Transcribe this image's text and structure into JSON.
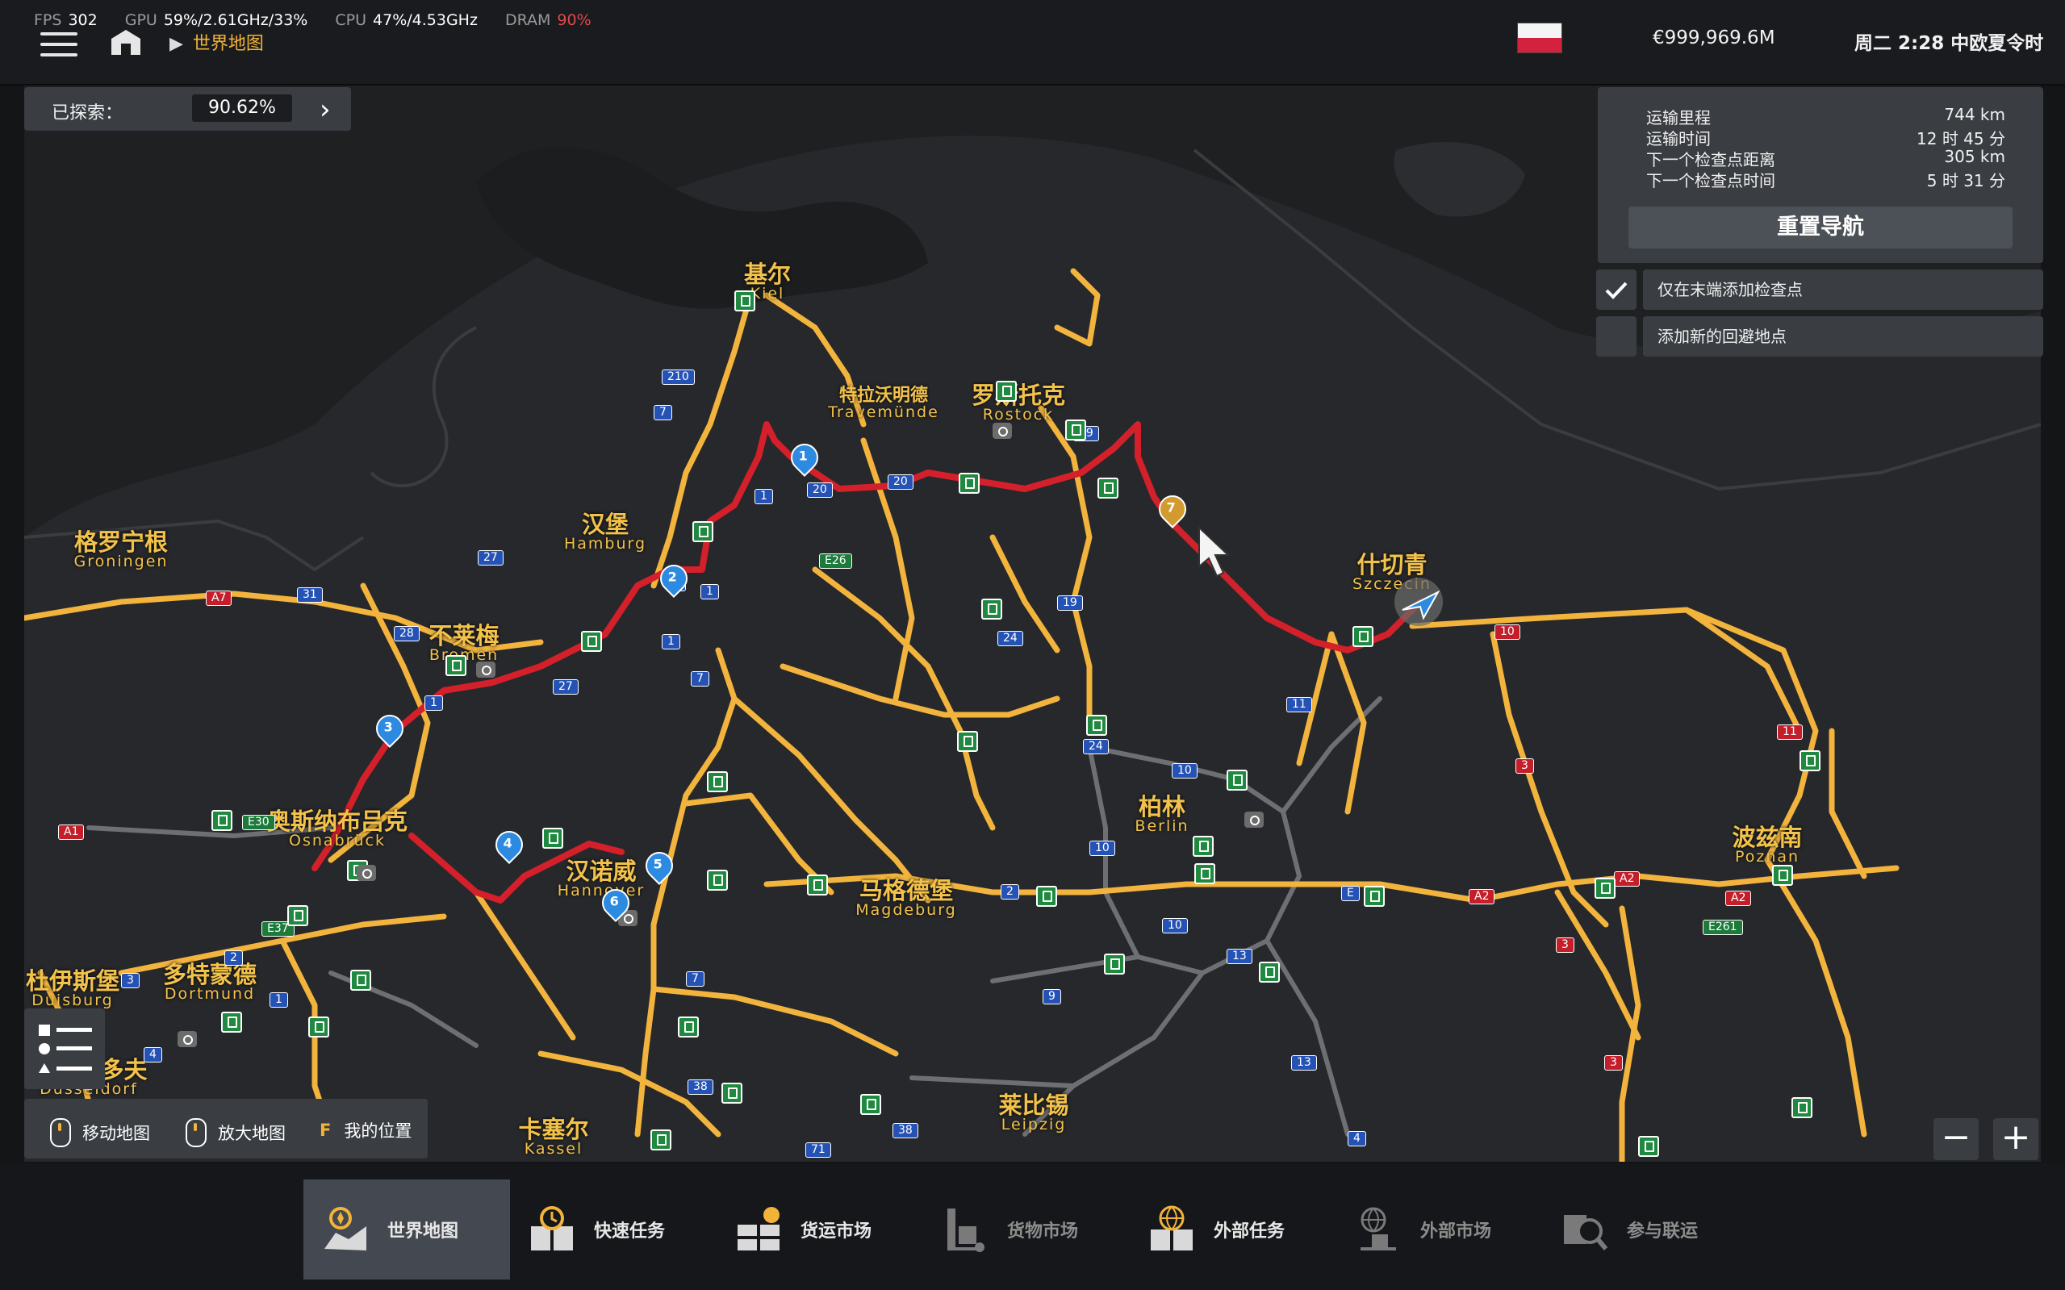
{
  "perf": {
    "fps_label": "FPS",
    "fps": "302",
    "gpu_label": "GPU",
    "gpu": "59%/2.61GHz/33%",
    "cpu_label": "CPU",
    "cpu": "47%/4.53GHz",
    "dram_label": "DRAM",
    "dram": "90%"
  },
  "header": {
    "breadcrumb": "世界地图",
    "money": "€999,969.6M",
    "clock": "周二 2:28 中欧夏令时"
  },
  "explored": {
    "label": "已探索：",
    "value": "90.62%"
  },
  "navigation": {
    "rows": [
      {
        "label": "运输里程",
        "value": "744 km"
      },
      {
        "label": "运输时间",
        "value": "12 时 45 分"
      },
      {
        "label": "下一个检查点距离",
        "value": "305 km"
      },
      {
        "label": "下一个检查点时间",
        "value": "5 时 31 分"
      }
    ],
    "reset_label": "重置导航",
    "options": [
      {
        "label": "仅在末端添加检查点",
        "checked": true
      },
      {
        "label": "添加新的回避地点",
        "checked": false
      }
    ]
  },
  "controls": {
    "move_label": "移动地图",
    "zoom_label": "放大地图",
    "locate_key": "F",
    "locate_label": "我的位置",
    "zoom_out": "−",
    "zoom_in": "+"
  },
  "cities": [
    {
      "cn": "基尔",
      "lat": "Kiel"
    },
    {
      "cn": "特拉沃明德",
      "lat": "Travemünde"
    },
    {
      "cn": "罗斯托克",
      "lat": "Rostock"
    },
    {
      "cn": "汉堡",
      "lat": "Hamburg"
    },
    {
      "cn": "格罗宁根",
      "lat": "Groningen"
    },
    {
      "cn": "不莱梅",
      "lat": "Bremen"
    },
    {
      "cn": "什切青",
      "lat": "Szczecin"
    },
    {
      "cn": "奥斯纳布吕克",
      "lat": "Osnabrück"
    },
    {
      "cn": "汉诺威",
      "lat": "Hannover"
    },
    {
      "cn": "柏林",
      "lat": "Berlin"
    },
    {
      "cn": "马格德堡",
      "lat": "Magdeburg"
    },
    {
      "cn": "波兹南",
      "lat": "Poznan"
    },
    {
      "cn": "杜伊斯堡",
      "lat": "Duisburg"
    },
    {
      "cn": "多特蒙德",
      "lat": "Dortmund"
    },
    {
      "cn": "杜塞尔多夫",
      "lat": "Düsseldorf"
    },
    {
      "cn": "卡塞尔",
      "lat": "Kassel"
    },
    {
      "cn": "莱比锡",
      "lat": "Leipzig"
    }
  ],
  "road_shields": [
    "210",
    "7",
    "1",
    "20",
    "20",
    "19",
    "E26",
    "2",
    "1",
    "A7",
    "31",
    "28",
    "27",
    "1",
    "27",
    "7",
    "24",
    "19",
    "10",
    "3",
    "11",
    "10",
    "11",
    "A1",
    "E30",
    "1",
    "24",
    "10",
    "E37",
    "2",
    "3",
    "1",
    "4",
    "7",
    "38",
    "71",
    "38",
    "9",
    "13",
    "4",
    "10",
    "2",
    "A2",
    "A2",
    "E261",
    "3",
    "3",
    "E",
    "A2",
    "13"
  ],
  "waypoints": [
    "1",
    "2",
    "3",
    "4",
    "5",
    "6",
    "7"
  ],
  "tabs": [
    {
      "label": "世界地图",
      "active": true
    },
    {
      "label": "快速任务"
    },
    {
      "label": "货运市场"
    },
    {
      "label": "货物市场",
      "dim": true
    },
    {
      "label": "外部任务"
    },
    {
      "label": "外部市场",
      "dim": true
    },
    {
      "label": "参与联运",
      "dim": true
    }
  ],
  "colors": {
    "route": "#d4202a",
    "road": "#f3b43d",
    "accent": "#f2b33a",
    "panel": "#3a3d42",
    "active_tab": "#434851"
  }
}
